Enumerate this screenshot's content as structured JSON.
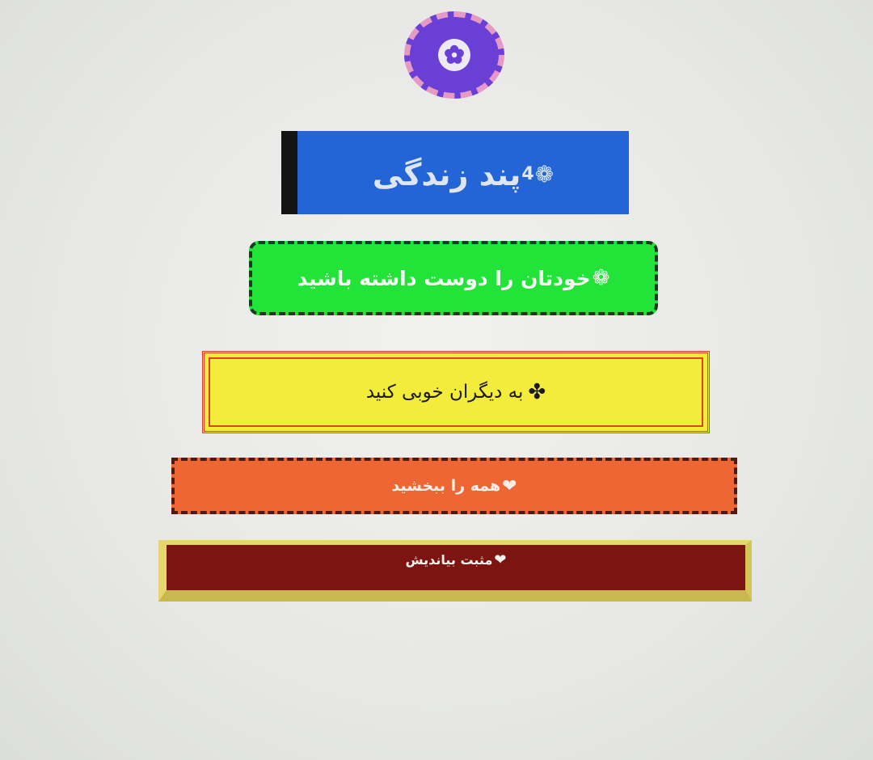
{
  "logo": {
    "icon": "flower-icon",
    "colors": {
      "fill": "#6a3fd6",
      "ring": "#e59ac6"
    }
  },
  "title": {
    "prefix_symbol": "❁",
    "number": "4",
    "text": "پند زندگی",
    "colors": {
      "background": "#2365d6",
      "accent_bar": "#141414"
    }
  },
  "lessons": [
    {
      "symbol": "❁",
      "text": "خودتان را دوست داشته باشید",
      "color": "#22e338"
    },
    {
      "symbol": "✤",
      "text": "به دیگران خوبی کنید",
      "color": "#f4ec3a"
    },
    {
      "symbol": "❤",
      "text": "همه را ببخشید",
      "color": "#ee6634"
    },
    {
      "symbol": "❤",
      "text": "مثبت بیاندیش",
      "color": "#7c1511"
    }
  ]
}
